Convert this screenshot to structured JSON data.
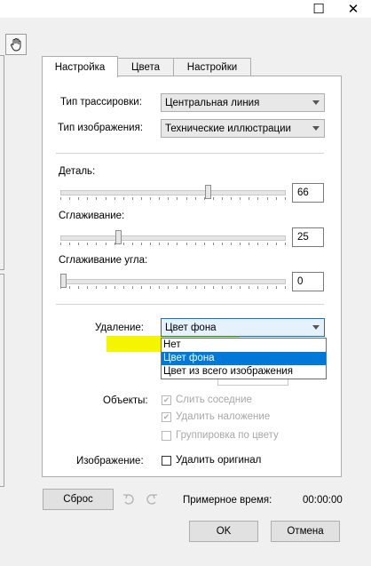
{
  "window": {
    "maximize_glyph": "☐",
    "close_glyph": "✕"
  },
  "tabs": [
    {
      "label": "Настройка",
      "active": true
    },
    {
      "label": "Цвета",
      "active": false
    },
    {
      "label": "Настройки",
      "active": false
    }
  ],
  "tracing": {
    "trace_type_label": "Тип трассировки:",
    "trace_type_value": "Центральная линия",
    "image_type_label": "Тип изображения:",
    "image_type_value": "Технические иллюстрации"
  },
  "sliders": {
    "detail": {
      "label": "Деталь:",
      "value": "66",
      "level": 0.66
    },
    "smoothing": {
      "label": "Сглаживание:",
      "value": "25",
      "level": 0.25
    },
    "corner": {
      "label": "Сглаживание угла:",
      "value": "0",
      "level": 0
    }
  },
  "removal": {
    "label": "Удаление:",
    "value": "Цвет фона",
    "options": [
      "Нет",
      "Цвет фона",
      "Цвет из всего изображения"
    ],
    "selected_index": 1
  },
  "objects": {
    "label": "Объекты:",
    "merge_adjacent": {
      "label": "Слить соседние",
      "checked": true,
      "disabled": true
    },
    "remove_overlap": {
      "label": "Удалить наложение",
      "checked": true,
      "disabled": true
    },
    "group_by_color": {
      "label": "Группировка по цвету",
      "checked": false,
      "disabled": true
    }
  },
  "image": {
    "label": "Изображение:",
    "delete_original": {
      "label": "Удалить оригинал",
      "checked": false
    }
  },
  "footer": {
    "reset_label": "Сброс",
    "estimated_time_label": "Примерное время:",
    "estimated_time_value": "00:00:00",
    "ok_label": "OK",
    "cancel_label": "Отмена"
  },
  "colors": {
    "selection": "#0078d7",
    "highlight_marker": "#f5f500"
  }
}
